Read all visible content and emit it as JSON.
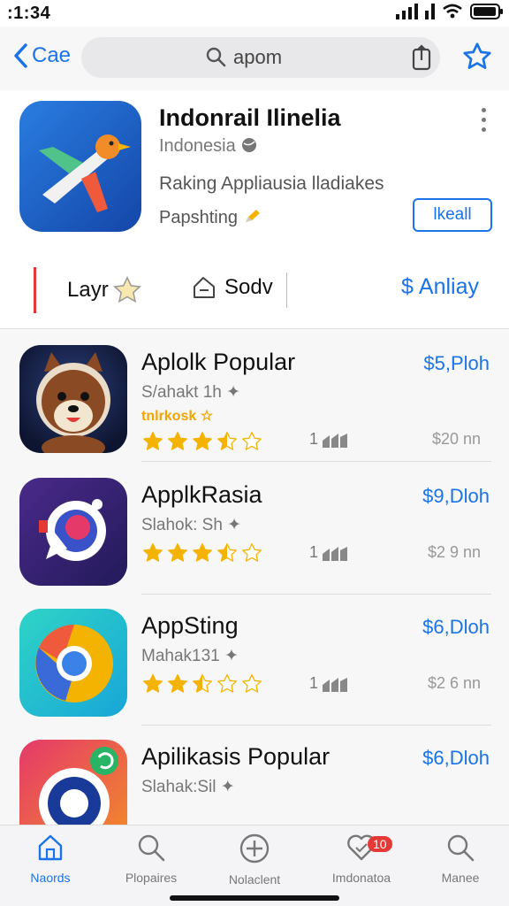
{
  "status_bar": {
    "time": ":1:34"
  },
  "nav": {
    "back_label": "Cae",
    "search_text": "apom"
  },
  "featured": {
    "title": "Indonrail Ilinelia",
    "subtitle": "Indonesia",
    "description": "Raking Appliausia lladiakes",
    "tag": "Papshting",
    "install_label": "lkeall"
  },
  "filters": [
    {
      "label": "Layr"
    },
    {
      "label": "Sodv"
    },
    {
      "label": "Anliay"
    }
  ],
  "apps": [
    {
      "name": "Aplolk Popular",
      "price": "$5,Ploh",
      "developer": "S/ahakt 1h",
      "badge": "tnlrkosk",
      "rating": 3.5,
      "stat": "1",
      "size": "$20 nn"
    },
    {
      "name": "ApplkRasia",
      "price": "$9,Dloh",
      "developer": "Slahok: Sh",
      "badge": "",
      "rating": 3.5,
      "stat": "1",
      "size": "$2 9 nn"
    },
    {
      "name": "AppSting",
      "price": "$6,Dloh",
      "developer": "Mahak131",
      "badge": "",
      "rating": 2.5,
      "stat": "1",
      "size": "$2 6 nn"
    },
    {
      "name": "Apilikasis Popular",
      "price": "$6,Dloh",
      "developer": "Slahak:Sil",
      "badge": "",
      "rating": 0,
      "stat": "",
      "size": ""
    }
  ],
  "tabbar": [
    {
      "label": "Naords",
      "icon": "home-icon",
      "active": true
    },
    {
      "label": "Plopaires",
      "icon": "search-icon",
      "active": false
    },
    {
      "label": "Nolaclent",
      "icon": "plus-circle-icon",
      "active": false
    },
    {
      "label": "Imdonatoa",
      "icon": "heart-icon",
      "active": false,
      "badge": "10"
    },
    {
      "label": "Manee",
      "icon": "search-icon",
      "active": false
    }
  ],
  "colors": {
    "accent": "#1a73e8",
    "star": "#f5b301",
    "badge_red": "#e53935"
  }
}
